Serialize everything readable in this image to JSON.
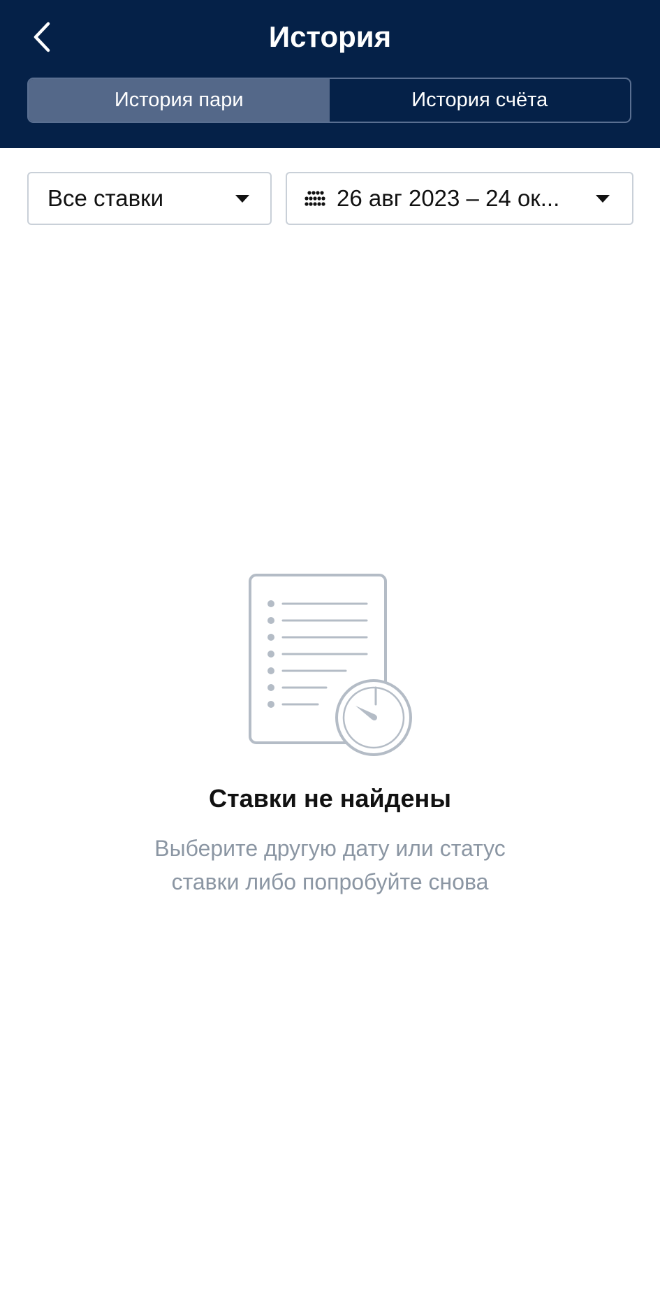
{
  "header": {
    "title": "История",
    "tabs": [
      {
        "label": "История пари",
        "active": true
      },
      {
        "label": "История счёта",
        "active": false
      }
    ]
  },
  "filters": {
    "status": {
      "value": "Все ставки"
    },
    "date_range": {
      "value": "26 авг 2023 – 24 ок..."
    }
  },
  "empty_state": {
    "title": "Ставки не найдены",
    "description": "Выберите другую дату или статус ставки либо попробуйте снова"
  },
  "icons": {
    "back": "chevron-left-icon",
    "calendar": "calendar-dots-icon",
    "dropdown": "caret-down-icon",
    "illustration": "document-clock-icon"
  },
  "colors": {
    "header_bg": "#052148",
    "tab_active_bg": "#546889",
    "muted_text": "#8b96a3"
  }
}
